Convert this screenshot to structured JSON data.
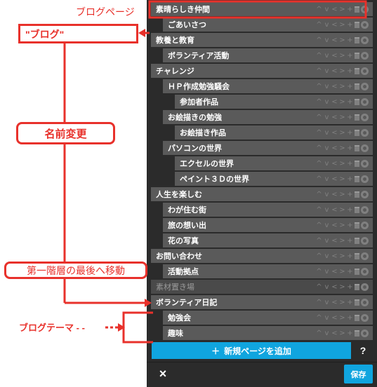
{
  "annotations": {
    "blog_page": "ブログページ",
    "blog_quote": "\"ブログ\"",
    "rename": "名前変更",
    "move_last": "第一階層の最後へ移動",
    "blog_theme": "ブログテーマ",
    "dashes": "- -"
  },
  "colors": {
    "annotation_red": "#e8312b",
    "accent_blue": "#10a5df",
    "panel_bg": "#2b2b2b",
    "row_bg": "#5a5a5a"
  },
  "pages": [
    {
      "label": "素晴らしき仲間",
      "level": 0
    },
    {
      "label": "ごあいさつ",
      "level": 1
    },
    {
      "label": "教養と教育",
      "level": 0
    },
    {
      "label": "ボランティア活動",
      "level": 1
    },
    {
      "label": "チャレンジ",
      "level": 0
    },
    {
      "label": "ＨＰ作成勉強騒会",
      "level": 1
    },
    {
      "label": "参加者作品",
      "level": 2
    },
    {
      "label": "お絵描きの勉強",
      "level": 1
    },
    {
      "label": "お絵描き作品",
      "level": 2
    },
    {
      "label": "パソコンの世界",
      "level": 1
    },
    {
      "label": "エクセルの世界",
      "level": 2
    },
    {
      "label": "ペイント３Ｄの世界",
      "level": 2
    },
    {
      "label": "人生を楽しむ",
      "level": 0
    },
    {
      "label": "わが住む街",
      "level": 1
    },
    {
      "label": "旅の想い出",
      "level": 1
    },
    {
      "label": "花の写真",
      "level": 1
    },
    {
      "label": "お問い合わせ",
      "level": 0
    },
    {
      "label": "活動拠点",
      "level": 1
    },
    {
      "label": "素材置き場",
      "level": 0,
      "dim": true
    },
    {
      "label": "ボランティア日記",
      "level": 0
    },
    {
      "label": "勉強会",
      "level": 1
    },
    {
      "label": "趣味",
      "level": 1
    }
  ],
  "row_icons": [
    "chevron-up-icon",
    "chevron-down-icon",
    "chevron-left-icon",
    "chevron-right-icon",
    "plus-icon",
    "trash-icon",
    "eye-icon"
  ],
  "footer": {
    "add_page": "新規ページを追加",
    "help": "?",
    "close": "×",
    "save": "保存"
  }
}
